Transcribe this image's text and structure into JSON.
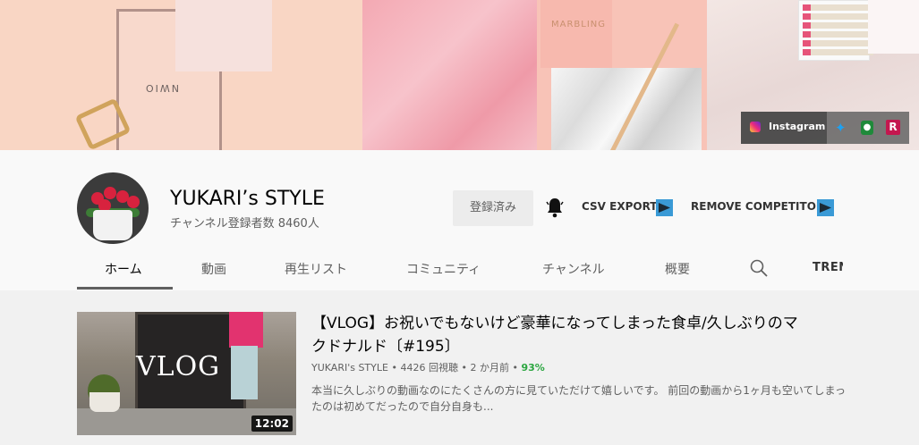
{
  "banner": {
    "decor_text_1": "NWIO",
    "decor_text_2": "MARBLING",
    "links": {
      "instagram_label": "Instagram",
      "icons": [
        "instagram-icon",
        "twitter-icon",
        "goodreads-icon",
        "rakuten-icon"
      ]
    }
  },
  "channel": {
    "name": "YUKARI’s STYLE",
    "subscribers": "チャンネル登録者数 8460人",
    "subscribe_label": "登録済み",
    "csv_export": "CSV EXPORT",
    "remove_competitor": "REMOVE COMPETITOR"
  },
  "tabs": [
    {
      "label": "ホーム",
      "active": true
    },
    {
      "label": "動画"
    },
    {
      "label": "再生リスト"
    },
    {
      "label": "コミュニティ"
    },
    {
      "label": "チャンネル"
    },
    {
      "label": "概要"
    }
  ],
  "trend_label": "TREN",
  "video": {
    "thumbnail_text": "VLOG",
    "duration": "12:02",
    "title": "【VLOG】お祝いでもないけど豪華になってしまった食卓/久しぶりのマクドナルド〔#195〕",
    "meta_channel": "YUKARI's STYLE",
    "meta_views": "4426 回視聴",
    "meta_age": "2 か月前",
    "meta_percent": "93%",
    "description": "本当に久しぶりの動画なのにたくさんの方に見ていただけて嬉しいです。 前回の動画から1ヶ月も空いてしまったのは初めてだったので自分自身も..."
  },
  "colors": {
    "accent_green": "#2ba640",
    "ext_button_blue": "#3a9ad6"
  }
}
